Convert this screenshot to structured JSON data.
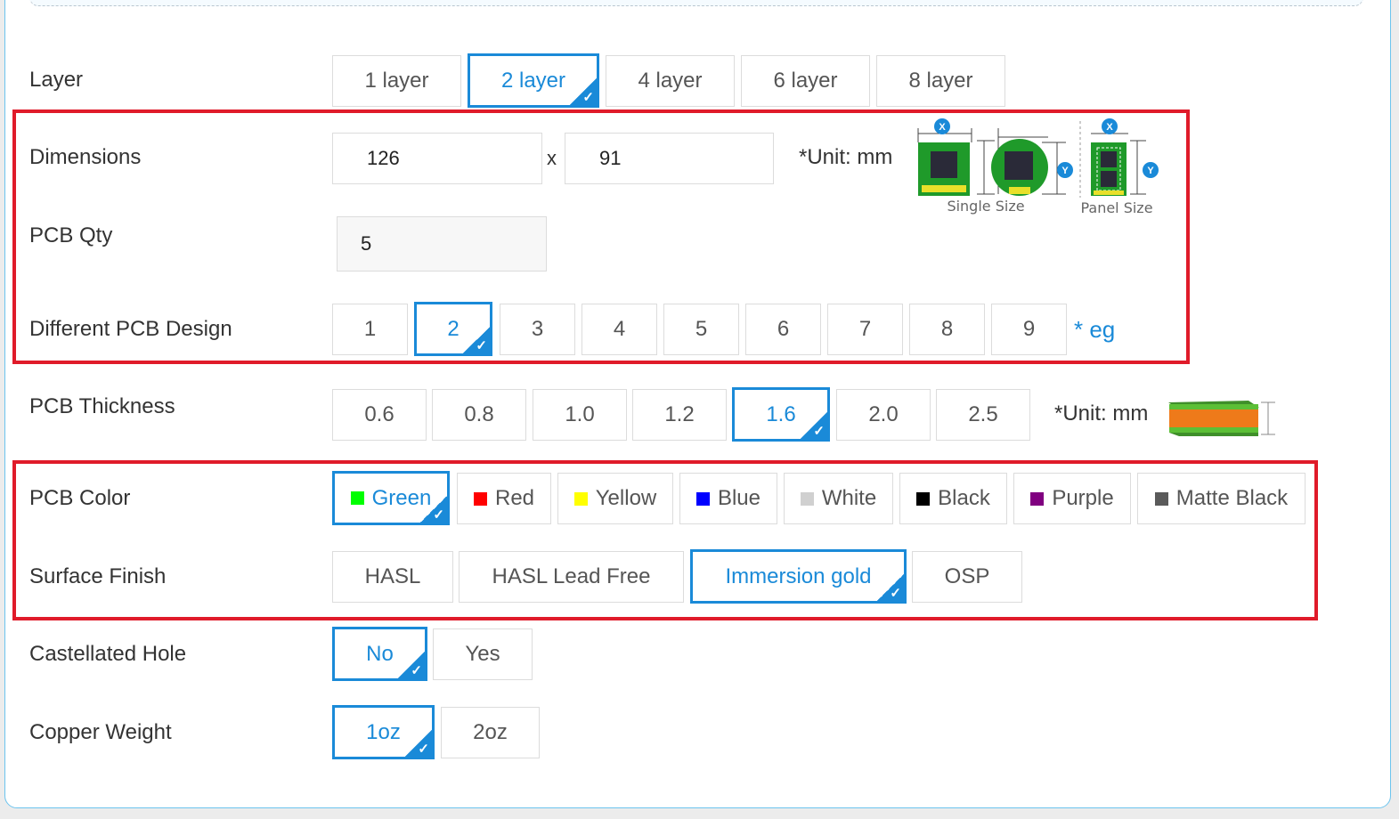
{
  "form": {
    "layer": {
      "label": "Layer",
      "options": [
        "1 layer",
        "2 layer",
        "4 layer",
        "6 layer",
        "8 layer"
      ],
      "selected": "2 layer"
    },
    "dimensions": {
      "label": "Dimensions",
      "width_value": "126",
      "height_value": "91",
      "separator": "x",
      "unit_note": "*Unit: mm",
      "diagram": {
        "single_size_caption": "Single Size",
        "panel_size_caption": "Panel Size",
        "x_marker": "X",
        "y_marker": "Y"
      }
    },
    "pcb_qty": {
      "label": "PCB Qty",
      "value": "5"
    },
    "different_design": {
      "label": "Different PCB Design",
      "options": [
        "1",
        "2",
        "3",
        "4",
        "5",
        "6",
        "7",
        "8",
        "9"
      ],
      "selected": "2",
      "eg_link": "* eg"
    },
    "thickness": {
      "label": "PCB Thickness",
      "options": [
        "0.6",
        "0.8",
        "1.0",
        "1.2",
        "1.6",
        "2.0",
        "2.5"
      ],
      "selected": "1.6",
      "unit_note": "*Unit: mm"
    },
    "color": {
      "label": "PCB Color",
      "options": [
        {
          "label": "Green",
          "swatch": "#00ff00"
        },
        {
          "label": "Red",
          "swatch": "#ff0000"
        },
        {
          "label": "Yellow",
          "swatch": "#ffff00"
        },
        {
          "label": "Blue",
          "swatch": "#0000ff"
        },
        {
          "label": "White",
          "swatch": "#d0d0d0"
        },
        {
          "label": "Black",
          "swatch": "#000000"
        },
        {
          "label": "Purple",
          "swatch": "#800080"
        },
        {
          "label": "Matte Black",
          "swatch": "#5a5a5a"
        }
      ],
      "selected": "Green"
    },
    "surface_finish": {
      "label": "Surface Finish",
      "options": [
        "HASL",
        "HASL Lead Free",
        "Immersion gold",
        "OSP"
      ],
      "selected": "Immersion gold"
    },
    "castellated_hole": {
      "label": "Castellated Hole",
      "options": [
        "No",
        "Yes"
      ],
      "selected": "No"
    },
    "copper_weight": {
      "label": "Copper Weight",
      "options": [
        "1oz",
        "2oz"
      ],
      "selected": "1oz"
    }
  },
  "colors": {
    "accent": "#1a8ad8",
    "highlight_box": "#e01b2a",
    "card_border": "#6cc4ee"
  }
}
